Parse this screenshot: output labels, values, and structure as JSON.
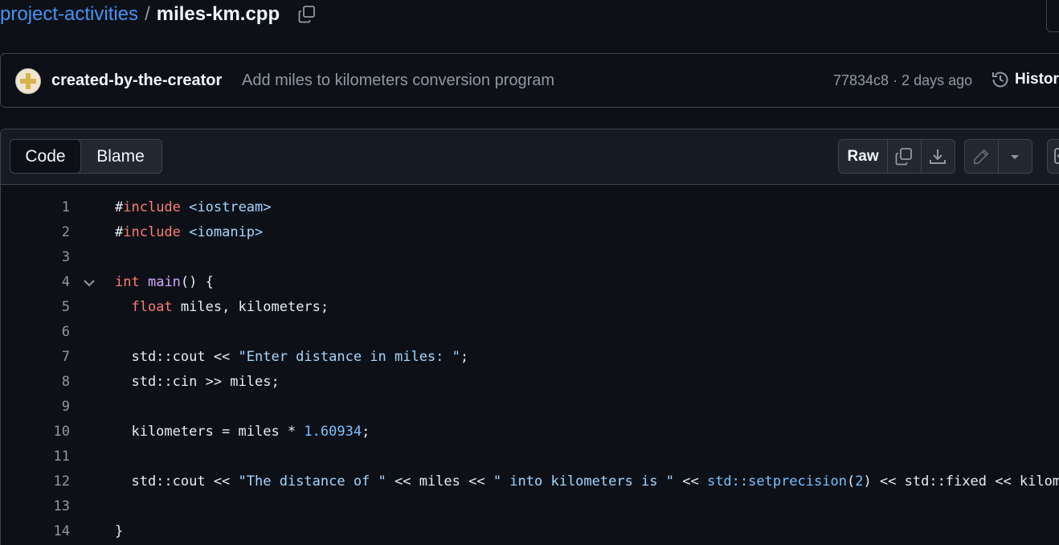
{
  "breadcrumb": {
    "repo": "project-activities",
    "separator": "/",
    "file": "miles-km.cpp"
  },
  "commit": {
    "author": "created-by-the-creator",
    "message": "Add miles to kilometers conversion program",
    "meta": "77834c8 · 2 days ago",
    "history_label": "History"
  },
  "file_header": {
    "tabs": [
      "Code",
      "Blame"
    ],
    "active_tab": "Code",
    "raw_label": "Raw"
  },
  "icons": {
    "copy_path": "copy-icon",
    "history": "history-icon",
    "copy_raw": "copy-icon",
    "download": "download-icon",
    "edit": "pencil-icon",
    "more": "triangle-down-icon",
    "symbols": "code-square-icon",
    "fold": "chevron-down-icon"
  },
  "colors": {
    "background": "#0d1117",
    "link": "#4493f8",
    "keyword": "#ff7b72",
    "string": "#a5d6ff",
    "number": "#79c0ff",
    "function": "#d2a8ff",
    "muted": "#9198a1"
  },
  "code": {
    "lines": [
      {
        "number": "1",
        "tokens": [
          [
            "plain",
            "#"
          ],
          [
            "kw",
            "include"
          ],
          [
            "plain",
            " "
          ],
          [
            "str",
            "<iostream>"
          ]
        ]
      },
      {
        "number": "2",
        "tokens": [
          [
            "plain",
            "#"
          ],
          [
            "kw",
            "include"
          ],
          [
            "plain",
            " "
          ],
          [
            "str",
            "<iomanip>"
          ]
        ]
      },
      {
        "number": "3",
        "tokens": []
      },
      {
        "number": "4",
        "fold": true,
        "tokens": [
          [
            "kw",
            "int"
          ],
          [
            "plain",
            " "
          ],
          [
            "fn",
            "main"
          ],
          [
            "plain",
            "() {"
          ]
        ]
      },
      {
        "number": "5",
        "tokens": [
          [
            "plain",
            "  "
          ],
          [
            "kw",
            "float"
          ],
          [
            "plain",
            " miles, kilometers;"
          ]
        ]
      },
      {
        "number": "6",
        "tokens": []
      },
      {
        "number": "7",
        "tokens": [
          [
            "plain",
            "  std::cout << "
          ],
          [
            "str",
            "\"Enter distance in miles: \""
          ],
          [
            "plain",
            ";"
          ]
        ]
      },
      {
        "number": "8",
        "tokens": [
          [
            "plain",
            "  std::cin >> miles;"
          ]
        ]
      },
      {
        "number": "9",
        "tokens": []
      },
      {
        "number": "10",
        "tokens": [
          [
            "plain",
            "  kilometers = miles * "
          ],
          [
            "num",
            "1.60934"
          ],
          [
            "plain",
            ";"
          ]
        ]
      },
      {
        "number": "11",
        "tokens": []
      },
      {
        "number": "12",
        "tokens": [
          [
            "plain",
            "  std::cout << "
          ],
          [
            "str",
            "\"The distance of \""
          ],
          [
            "plain",
            " << miles << "
          ],
          [
            "str",
            "\" into kilometers is \""
          ],
          [
            "plain",
            " << "
          ],
          [
            "const",
            "std::setprecision"
          ],
          [
            "plain",
            "("
          ],
          [
            "num",
            "2"
          ],
          [
            "plain",
            ") << std::fixed << kilome"
          ]
        ]
      },
      {
        "number": "13",
        "tokens": []
      },
      {
        "number": "14",
        "tokens": [
          [
            "plain",
            "}"
          ]
        ]
      }
    ]
  }
}
